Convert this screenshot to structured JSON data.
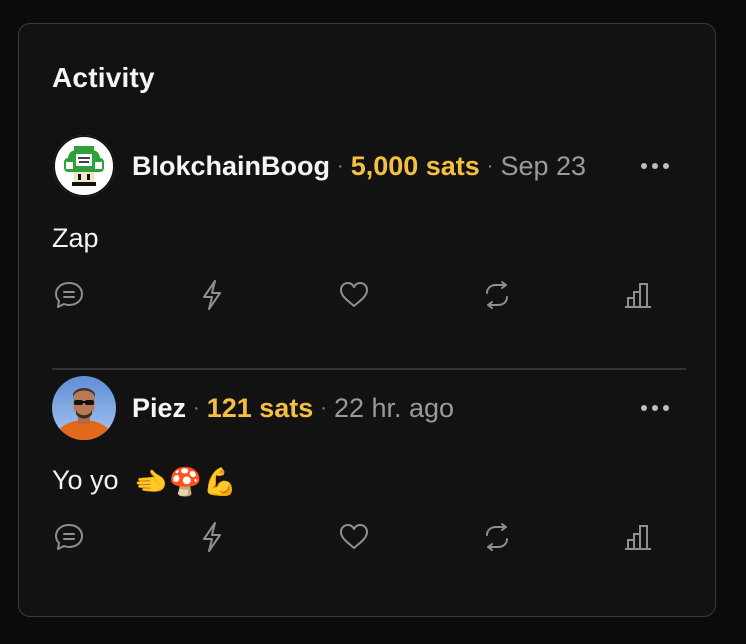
{
  "panel": {
    "title": "Activity"
  },
  "posts": [
    {
      "author": "BlokchainBoog",
      "separator1": "·",
      "sats": "5,000 sats",
      "separator2": "·",
      "time": "Sep 23",
      "content": "Zap",
      "avatar_icon": "mushroom-avatar",
      "actions": [
        "reply-icon",
        "zap-icon",
        "like-icon",
        "repost-icon",
        "stats-icon"
      ]
    },
    {
      "author": "Piez",
      "separator1": "·",
      "sats": "121 sats",
      "separator2": "·",
      "time": "22 hr. ago",
      "content": "Yo yo",
      "emojis": [
        "🫲",
        "🍄",
        "💪"
      ],
      "avatar_icon": "person-avatar",
      "actions": [
        "reply-icon",
        "zap-icon",
        "like-icon",
        "repost-icon",
        "stats-icon"
      ]
    }
  ],
  "colors": {
    "background": "#0b0b0b",
    "card": "#121212",
    "border": "#3a3a3a",
    "accent_sats": "#f5bf42",
    "text": "#f2f2f2",
    "muted": "#9a9a9a",
    "icon": "#8f8f8f"
  }
}
